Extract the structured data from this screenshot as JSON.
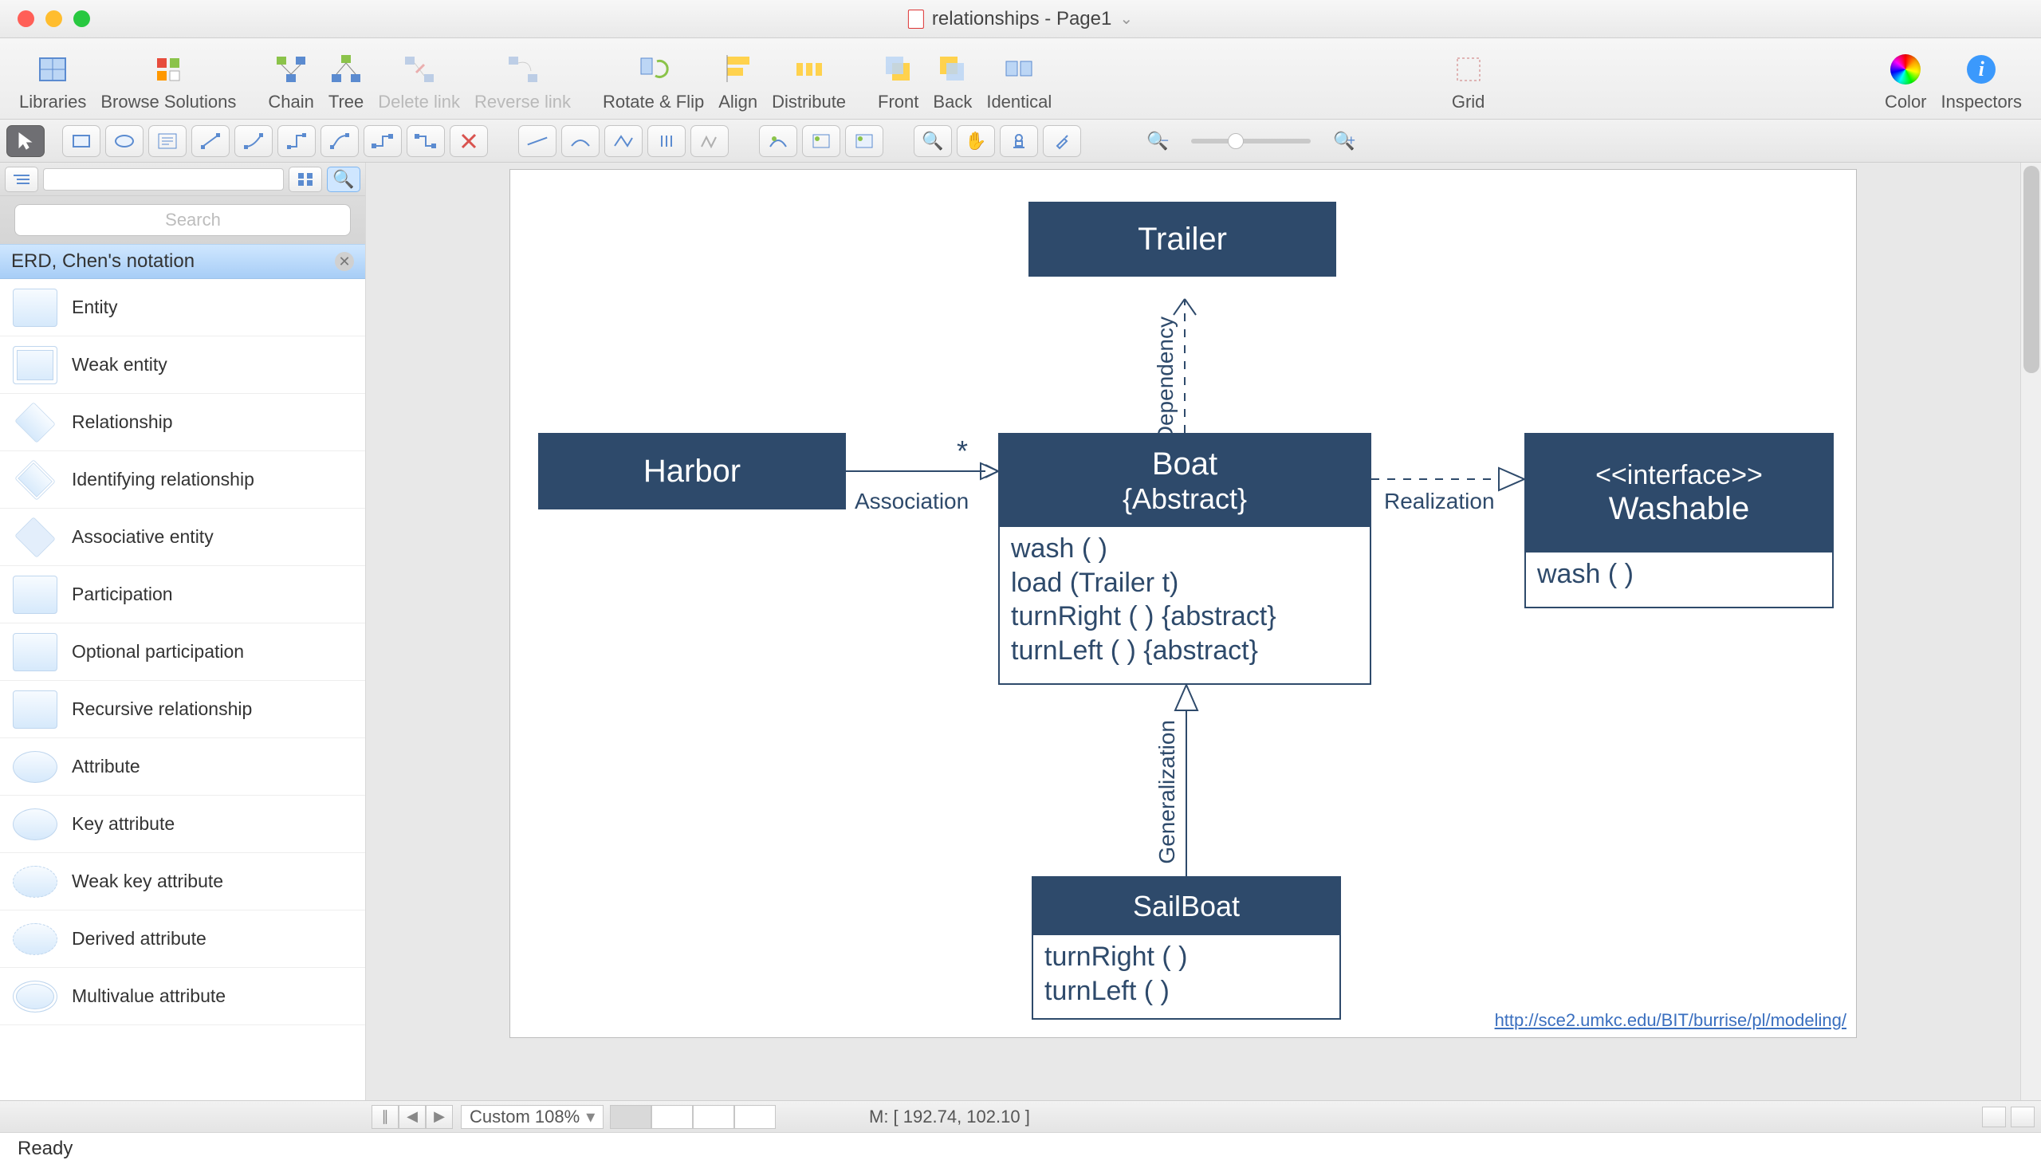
{
  "window": {
    "title": "relationships - Page1"
  },
  "toolbar": {
    "libraries": "Libraries",
    "browse": "Browse Solutions",
    "chain": "Chain",
    "tree": "Tree",
    "delete_link": "Delete link",
    "reverse_link": "Reverse link",
    "rotate_flip": "Rotate & Flip",
    "align": "Align",
    "distribute": "Distribute",
    "front": "Front",
    "back": "Back",
    "identical": "Identical",
    "grid": "Grid",
    "color": "Color",
    "inspectors": "Inspectors"
  },
  "sidebar": {
    "search_placeholder": "Search",
    "section": "ERD, Chen's notation",
    "items": [
      {
        "label": "Entity",
        "shape": "rect"
      },
      {
        "label": "Weak entity",
        "shape": "rect"
      },
      {
        "label": "Relationship",
        "shape": "diamond"
      },
      {
        "label": "Identifying relationship",
        "shape": "diamond"
      },
      {
        "label": "Associative entity",
        "shape": "diamond"
      },
      {
        "label": "Participation",
        "shape": "rect"
      },
      {
        "label": "Optional participation",
        "shape": "rect"
      },
      {
        "label": "Recursive relationship",
        "shape": "rect"
      },
      {
        "label": "Attribute",
        "shape": "oval"
      },
      {
        "label": "Key attribute",
        "shape": "oval"
      },
      {
        "label": "Weak key attribute",
        "shape": "oval"
      },
      {
        "label": "Derived attribute",
        "shape": "oval"
      },
      {
        "label": "Multivalue attribute",
        "shape": "oval"
      }
    ]
  },
  "diagram": {
    "trailer": {
      "title": "Trailer"
    },
    "harbor": {
      "title": "Harbor"
    },
    "boat": {
      "title": "Boat",
      "subtitle": "{Abstract}",
      "methods": [
        "wash ( )",
        "load (Trailer t)",
        "turnRight ( ) {abstract}",
        "turnLeft ( ) {abstract}"
      ]
    },
    "washable": {
      "stereo": "<<interface>>",
      "title": "Washable",
      "methods": [
        "wash ( )"
      ]
    },
    "sailboat": {
      "title": "SailBoat",
      "methods": [
        "turnRight ( )",
        "turnLeft ( )"
      ]
    },
    "labels": {
      "association": "Association",
      "dependency": "Dependency",
      "realization": "Realization",
      "generalization": "Generalization",
      "star": "*"
    },
    "footer_url": "http://sce2.umkc.edu/BIT/burrise/pl/modeling/"
  },
  "bottombar": {
    "zoom": "Custom 108%",
    "coords": "M: [ 192.74, 102.10 ]"
  },
  "status": {
    "ready": "Ready"
  }
}
